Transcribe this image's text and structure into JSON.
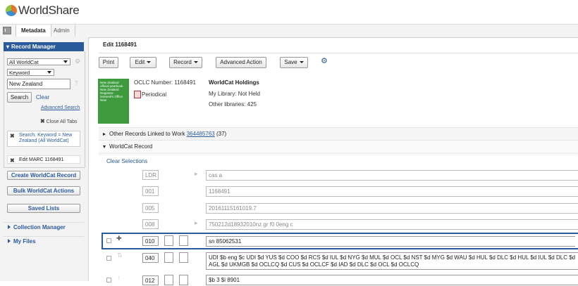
{
  "app": {
    "name": "WorldShare"
  },
  "tabs": [
    {
      "label": "Metadata"
    },
    {
      "label": "Admin"
    }
  ],
  "sidebar": {
    "record_manager": {
      "title": "Record Manager",
      "scope_select": "All WorldCat",
      "index_select": "Keyword",
      "search_value": "New Zealand",
      "search_button": "Search",
      "clear_link": "Clear",
      "advanced_search_link": "Advanced Search",
      "close_all_tabs": "Close All Tabs",
      "search_chip": "Search: Keyword = New Zealand (All WorldCat)",
      "edit_chip": "Edit MARC 1168491",
      "create_button": "Create WorldCat Record",
      "bulk_button": "Bulk WorldCat Actions",
      "saved_lists_button": "Saved Lists"
    },
    "sections": [
      {
        "label": "Collection Manager"
      },
      {
        "label": "My Files"
      }
    ]
  },
  "main": {
    "title": "Edit 1168491",
    "toolbar": {
      "print": "Print",
      "edit": "Edit",
      "record": "Record",
      "advanced_action": "Advanced Action",
      "save": "Save"
    },
    "record": {
      "cover_text": "New Zealand official yearbook New Zealand Registrar-General's Office New",
      "oclc_number": "OCLC Number: 1168491",
      "format": "Periodical",
      "holdings_title": "WorldCat Holdings",
      "my_library": "My Library: Not Held",
      "other_libraries": "Other libraries: 425"
    },
    "linked_section": {
      "prefix": "Other Records Linked to Work",
      "work_id": "364485763",
      "count": "(37)"
    },
    "worldcat_section": {
      "label": "WorldCat Record"
    },
    "clear_selections": "Clear Selections",
    "marc_rows": [
      {
        "tag": "LDR",
        "value": "cas  a"
      },
      {
        "tag": "001",
        "value": "1168491"
      },
      {
        "tag": "005",
        "value": "20161115161019.7"
      },
      {
        "tag": "008",
        "value": "750212d18932010nz gr      f0    0eng c"
      },
      {
        "tag": "010",
        "value": "sn 85062531"
      },
      {
        "tag": "040",
        "value": "UDI $b eng $c UDI $d YUS $d COO $d RCS $d IUL $d NYG $d MUL $d OCL $d NST $d MYG $d WAU $d HUL $d DLC $d HUL $d IUL $d DLC $d AGL $d UKMGB $d OCLCQ $d CUS $d OCLCF $d IAD $d DLC $d OCL $d OCLCQ"
      },
      {
        "tag": "012",
        "value": "$b 3 $i 8901"
      }
    ]
  },
  "colors": {
    "accent": "#2a5a9b",
    "selected_row": "#2a5a9b",
    "cover": "#3d9a3d"
  },
  "icons": [
    "gear-icon",
    "help-icon",
    "close-icon",
    "drag-handle-icon",
    "insert-row-icon",
    "move-up-icon",
    "periodical-icon",
    "expand-arrow-icon"
  ]
}
